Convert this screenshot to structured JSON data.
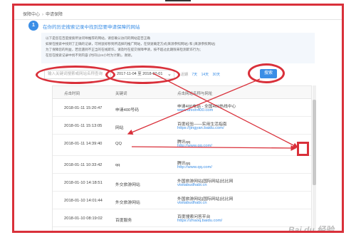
{
  "breadcrumb": {
    "home": "保障中心",
    "current": "申请保障"
  },
  "step": {
    "number": "1",
    "text": "在你的历史搜索记录中找到您要申请保障的网站"
  },
  "notice": {
    "line1": "以下是您在百度搜索所访问导推荐的网站，请您确认访问的网站是否正确",
    "line2": "如果在搜索中找到了正确的记录，可将鼠标移到所选择的推广网站，在快速确定方式(来源参照网站) 和 (来源参照网站)",
    "line2_link1": "(来源参照网站)",
    "line2_link2": "(来源参照网站)",
    "line3": "为了保障您的利益，若您遇到不正当的在线欺诈，请及时在提交保障申请，按不超过此期限来检测欺诈行为；",
    "line4": "在您在搜索记录中找不到内容 (时间以24小时为计算)，谢谢。"
  },
  "search": {
    "placeholder": "输入关键词搜索或网站名称查询"
  },
  "date_range": {
    "value": "2017-11-04 至 2018-02-01"
  },
  "quick_ranges": {
    "label": "近期",
    "options": [
      "7天",
      "14天",
      "30天"
    ]
  },
  "search_button": {
    "label": "搜索"
  },
  "table": {
    "headers": {
      "time": "点击时间",
      "keyword": "关键词",
      "site": "点击网站名称与网址",
      "select": "选择"
    },
    "rows": [
      {
        "time": "2018-01-11 15:20:47",
        "keyword": "申请400号码",
        "site": "申请400电话 - 全国400热线中心",
        "url": "www.union400.com"
      },
      {
        "time": "2018-01-11 15:13:05",
        "keyword": "网站",
        "site": "百度经验——实用生活指南",
        "url": "https://jingyan.baidu.com/"
      },
      {
        "time": "2018-01-11 14:39:40",
        "keyword": "QQ",
        "site": "腾讯qq",
        "url": "http://www.qq.com/"
      },
      {
        "time": "2018-01-11 10:33:42",
        "keyword": "qq",
        "site": "腾讯qq",
        "url": "http://www.qq.com/"
      },
      {
        "time": "2018-01-10 14:18:51",
        "keyword": "外交旅游网站",
        "site": "外国旅游网站|国际网站|比比网",
        "url": "visitabudhabi.cn"
      },
      {
        "time": "2018-01-10 14:01:44",
        "keyword": "外交旅游网站",
        "site": "外国旅游网站|国际网站|比比网",
        "url": "visitabudhabi.cn"
      },
      {
        "time": "2018-01-10 08:19:02",
        "keyword": "百度服务",
        "site": "百度搜索问答平台",
        "url": "https://zhaoq.baidu.com/"
      }
    ]
  },
  "watermark": {
    "text": "Bai du 经验"
  },
  "colors": {
    "annotation": "#d9303a",
    "accent": "#3a8ee6",
    "notice_bg": "#f3f7fc"
  }
}
